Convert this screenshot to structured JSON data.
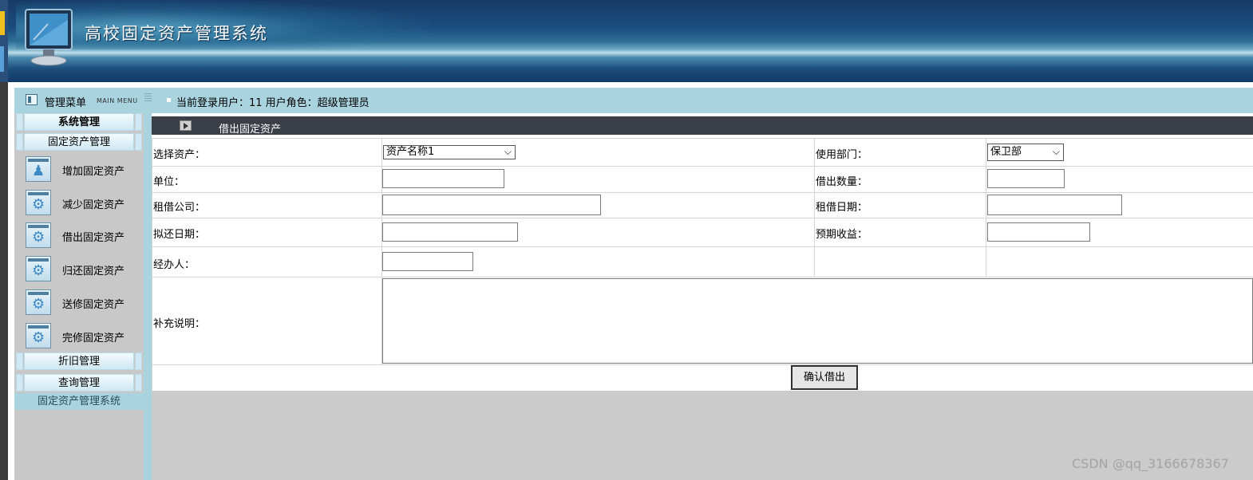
{
  "app": {
    "title": "高校固定资产管理系统"
  },
  "menubar": {
    "menu_title": "管理菜单",
    "menu_subtitle": "MAIN MENU",
    "user_info": "当前登录用户：11   用户角色：超级管理员"
  },
  "sidebar": {
    "groups": [
      {
        "label": "系统管理"
      },
      {
        "label": "固定资产管理"
      },
      {
        "label": "折旧管理"
      },
      {
        "label": "查询管理"
      }
    ],
    "items": [
      {
        "label": "增加固定资产",
        "icon": "person-icon"
      },
      {
        "label": "减少固定资产",
        "icon": "gear-icon"
      },
      {
        "label": "借出固定资产",
        "icon": "gear-icon"
      },
      {
        "label": "归还固定资产",
        "icon": "gear-icon"
      },
      {
        "label": "送修固定资产",
        "icon": "gear-icon"
      },
      {
        "label": "完修固定资产",
        "icon": "gear-icon"
      }
    ],
    "footer": "固定资产管理系统"
  },
  "page": {
    "title": "借出固定资产"
  },
  "form": {
    "asset_label": "选择资产：",
    "asset_value": "资产名称1",
    "department_label": "使用部门：",
    "department_value": "保卫部",
    "unit_label": "单位：",
    "lend_qty_label": "借出数量：",
    "company_label": "租借公司：",
    "lend_date_label": "租借日期：",
    "return_date_label": "拟还日期：",
    "expected_income_label": "预期收益：",
    "handler_label": "经办人：",
    "notes_label": "补充说明：",
    "submit_label": "确认借出"
  },
  "watermark": "CSDN @qq_3166678367",
  "colors": {
    "header": "#1b4d7e",
    "menubar": "#a9d3de",
    "subbar": "#3a3f48",
    "sidebar": "#c8c8c8"
  }
}
